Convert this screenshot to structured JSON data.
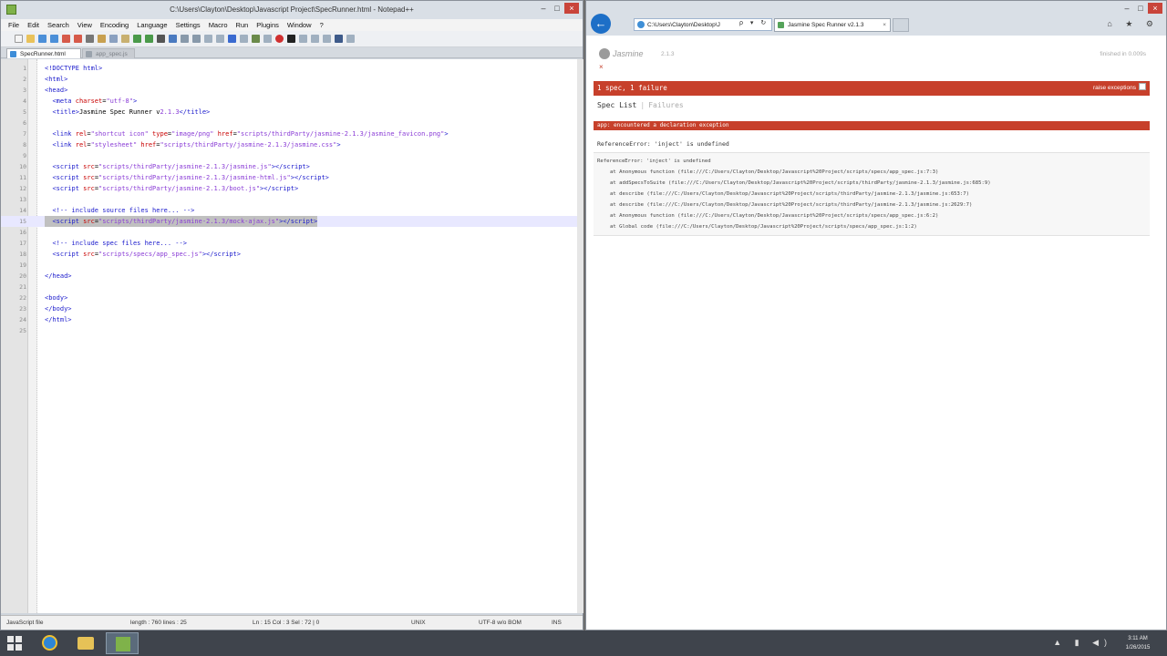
{
  "npp": {
    "title": "C:\\Users\\Clayton\\Desktop\\Javascript Project\\SpecRunner.html - Notepad++",
    "menu": [
      "File",
      "Edit",
      "Search",
      "View",
      "Encoding",
      "Language",
      "Settings",
      "Macro",
      "Run",
      "Plugins",
      "Window",
      "?"
    ],
    "tabs": [
      "SpecRunner.html",
      "app_spec.js"
    ],
    "lines": [
      {
        "n": "1",
        "html": "<span class=\"t\">&lt;!DOCTYPE html&gt;</span>"
      },
      {
        "n": "2",
        "html": "<span class=\"t\">&lt;html&gt;</span>"
      },
      {
        "n": "3",
        "html": "<span class=\"t\">&lt;head&gt;</span>"
      },
      {
        "n": "4",
        "html": "  <span class=\"t\">&lt;meta </span><span class=\"a\">charset</span><span class=\"x\">=</span><span class=\"v\">\"utf-8\"</span><span class=\"t\">&gt;</span>"
      },
      {
        "n": "5",
        "html": "  <span class=\"t\">&lt;title&gt;</span><span class=\"x\">Jasmine Spec Runner v</span><span class=\"v\">2.1.3</span><span class=\"t\">&lt;/title&gt;</span>"
      },
      {
        "n": "6",
        "html": ""
      },
      {
        "n": "7",
        "html": "  <span class=\"t\">&lt;link </span><span class=\"a\">rel</span><span class=\"x\">=</span><span class=\"v\">\"shortcut icon\"</span> <span class=\"a\">type</span><span class=\"x\">=</span><span class=\"v\">\"image/png\"</span> <span class=\"a\">href</span><span class=\"x\">=</span><span class=\"v\">\"scripts/thirdParty/jasmine-2.1.3/jasmine_favicon.png\"</span><span class=\"t\">&gt;</span>"
      },
      {
        "n": "8",
        "html": "  <span class=\"t\">&lt;link </span><span class=\"a\">rel</span><span class=\"x\">=</span><span class=\"v\">\"stylesheet\"</span> <span class=\"a\">href</span><span class=\"x\">=</span><span class=\"v\">\"scripts/thirdParty/jasmine-2.1.3/jasmine.css\"</span><span class=\"t\">&gt;</span>"
      },
      {
        "n": "9",
        "html": ""
      },
      {
        "n": "10",
        "html": "  <span class=\"t\">&lt;script </span><span class=\"a\">src</span><span class=\"x\">=</span><span class=\"v\">\"scripts/thirdParty/jasmine-2.1.3/jasmine.js\"</span><span class=\"t\">&gt;&lt;/script&gt;</span>"
      },
      {
        "n": "11",
        "html": "  <span class=\"t\">&lt;script </span><span class=\"a\">src</span><span class=\"x\">=</span><span class=\"v\">\"scripts/thirdParty/jasmine-2.1.3/jasmine-html.js\"</span><span class=\"t\">&gt;&lt;/script&gt;</span>"
      },
      {
        "n": "12",
        "html": "  <span class=\"t\">&lt;script </span><span class=\"a\">src</span><span class=\"x\">=</span><span class=\"v\">\"scripts/thirdParty/jasmine-2.1.3/boot.js\"</span><span class=\"t\">&gt;&lt;/script&gt;</span>"
      },
      {
        "n": "13",
        "html": ""
      },
      {
        "n": "14",
        "html": "  <span class=\"c\">&lt;!-- include source files here... --&gt;</span>"
      },
      {
        "n": "15",
        "html": "  <span class=\"t\">&lt;script </span><span class=\"a\">src</span><span class=\"x\">=</span><span class=\"v\">\"scripts/thirdParty/jasmine-2.1.3/mock-ajax.js\"</span><span class=\"t\">&gt;&lt;/script&gt;</span>",
        "hl": true
      },
      {
        "n": "16",
        "html": ""
      },
      {
        "n": "17",
        "html": "  <span class=\"c\">&lt;!-- include spec files here... --&gt;</span>"
      },
      {
        "n": "18",
        "html": "  <span class=\"t\">&lt;script </span><span class=\"a\">src</span><span class=\"x\">=</span><span class=\"v\">\"scripts/specs/app_spec.js\"</span><span class=\"t\">&gt;&lt;/script&gt;</span>"
      },
      {
        "n": "19",
        "html": ""
      },
      {
        "n": "20",
        "html": "<span class=\"t\">&lt;/head&gt;</span>"
      },
      {
        "n": "21",
        "html": ""
      },
      {
        "n": "22",
        "html": "<span class=\"t\">&lt;body&gt;</span>"
      },
      {
        "n": "23",
        "html": "<span class=\"t\">&lt;/body&gt;</span>"
      },
      {
        "n": "24",
        "html": "<span class=\"t\">&lt;/html&gt;</span>"
      },
      {
        "n": "25",
        "html": ""
      }
    ],
    "status": {
      "filetype": "JavaScript file",
      "length": "length : 760    lines : 25",
      "pos": "Ln : 15    Col : 3    Sel : 72 | 0",
      "eol": "UNIX",
      "encoding": "UTF-8 w/o BOM",
      "mode": "INS"
    }
  },
  "ie": {
    "address": "C:\\Users\\Clayton\\Desktop\\J",
    "address_ctrls": "ρ ▾ ↻ ×",
    "tab_title": "Jasmine Spec Runner v2.1.3",
    "tab_close": "×",
    "tools": "⌂ ★ ⚙",
    "back": "←",
    "jasmine": {
      "logo_text": "Jasmine",
      "version": "2.1.3",
      "finished": "finished in 0.009s",
      "x": "×",
      "summary": "1 spec, 1 failure",
      "raise_label": "raise exceptions",
      "spec_list": "Spec List",
      "sep": "|",
      "failures": "Failures",
      "fail_title": "app: encountered a declaration exception",
      "error": "ReferenceError: 'inject' is undefined",
      "stack": [
        "ReferenceError: 'inject' is undefined",
        "at Anonymous function (file:///C:/Users/Clayton/Desktop/Javascript%20Project/scripts/specs/app_spec.js:7:3)",
        "at addSpecsToSuite (file:///C:/Users/Clayton/Desktop/Javascript%20Project/scripts/thirdParty/jasmine-2.1.3/jasmine.js:685:9)",
        "at describe (file:///C:/Users/Clayton/Desktop/Javascript%20Project/scripts/thirdParty/jasmine-2.1.3/jasmine.js:653:7)",
        "at describe (file:///C:/Users/Clayton/Desktop/Javascript%20Project/scripts/thirdParty/jasmine-2.1.3/jasmine.js:2629:7)",
        "at Anonymous function (file:///C:/Users/Clayton/Desktop/Javascript%20Project/scripts/specs/app_spec.js:6:2)",
        "at Global code (file:///C:/Users/Clayton/Desktop/Javascript%20Project/scripts/specs/app_spec.js:1:2)"
      ]
    }
  },
  "taskbar": {
    "tray": "▲ ▮ ◀)",
    "time": "3:11 AM",
    "date": "1/26/2015"
  },
  "colors": {
    "jasmine_fail": "#c7402b",
    "ie_blue": "#1d6fc7",
    "npp_green": "#7fb24a"
  }
}
